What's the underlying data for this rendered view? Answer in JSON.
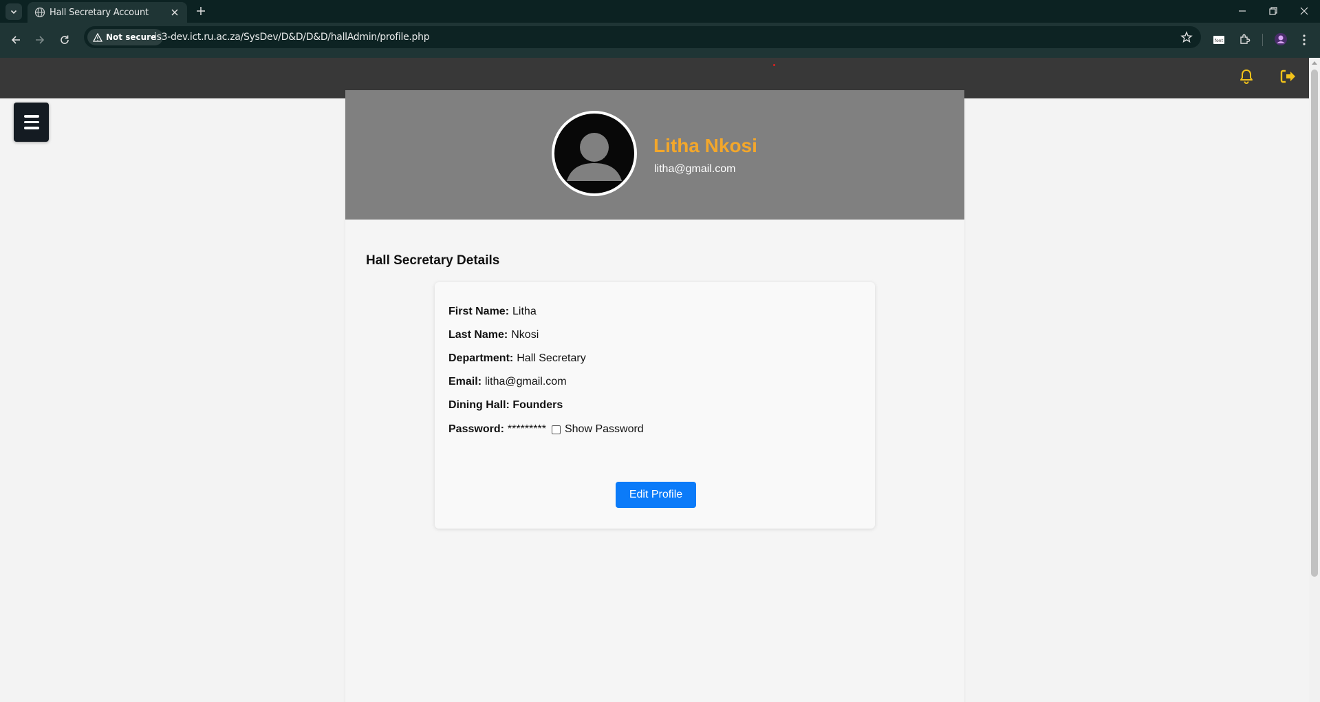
{
  "browser": {
    "tab_title": "Hall Secretary Account",
    "security_label": "Not secure",
    "url": "is3-dev.ict.ru.ac.za/SysDev/D&D/D&D/hallAdmin/profile.php",
    "icons": [
      "chevron-down-icon",
      "globe-icon",
      "close-icon",
      "plus-icon",
      "minimize-icon",
      "restore-icon",
      "back-icon",
      "forward-icon",
      "reload-icon",
      "warning-icon",
      "star-icon",
      "extension-icon",
      "puzzle-icon",
      "profile-icon",
      "kebab-menu-icon"
    ]
  },
  "header": {
    "icons": [
      "bell-icon",
      "logout-icon"
    ],
    "accent_color": "#f3c31a"
  },
  "profile": {
    "name": "Litha Nkosi",
    "email": "litha@gmail.com",
    "name_color": "#f3a72b"
  },
  "details": {
    "section_title": "Hall Secretary Details",
    "first_name_label": "First Name:",
    "first_name": "Litha",
    "last_name_label": "Last Name:",
    "last_name": "Nkosi",
    "department_label": "Department:",
    "department": "Hall Secretary",
    "email_label": "Email:",
    "email": "litha@gmail.com",
    "dining_hall": "Dining Hall: Founders",
    "password_label": "Password:",
    "password_mask": "*********",
    "show_password_label": "Show Password",
    "edit_button": "Edit Profile",
    "button_color": "#0b7bf9"
  }
}
